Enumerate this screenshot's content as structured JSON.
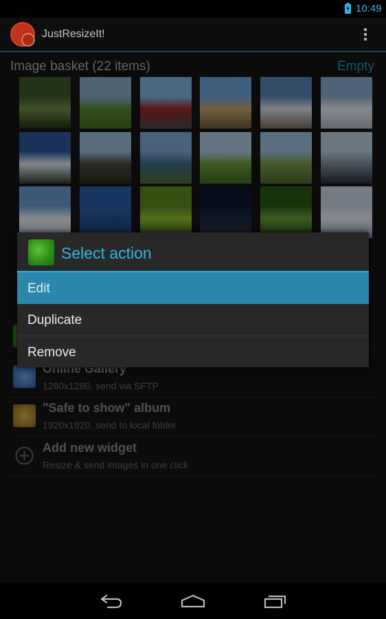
{
  "status": {
    "time": "10:49"
  },
  "app": {
    "title": "JustResizeIt!"
  },
  "basket": {
    "title": "Image basket (22 items)",
    "empty_label": "Empty"
  },
  "thumbnails": [
    {
      "name": "thumb-forest",
      "colors": [
        "#3d5a2a",
        "#6e8a48",
        "#1f3018"
      ]
    },
    {
      "name": "thumb-meadow",
      "colors": [
        "#87a9c9",
        "#5b8a2f",
        "#3e6b1e"
      ]
    },
    {
      "name": "thumb-train",
      "colors": [
        "#7fb3e3",
        "#9c2424",
        "#4a4a4a"
      ]
    },
    {
      "name": "thumb-building",
      "colors": [
        "#6ca2d8",
        "#c4a46a",
        "#6a5a3a"
      ]
    },
    {
      "name": "thumb-snow-hill",
      "colors": [
        "#5a85b8",
        "#d8dde5",
        "#7a6a5a"
      ]
    },
    {
      "name": "thumb-snow-mountains",
      "colors": [
        "#8aa9cc",
        "#e8eef5",
        "#a8b4bf"
      ]
    },
    {
      "name": "thumb-snowy-trees",
      "colors": [
        "#2d5b9a",
        "#e0e8f2",
        "#2f3a30"
      ]
    },
    {
      "name": "thumb-bare-trees",
      "colors": [
        "#9ab8d8",
        "#444a3a",
        "#2a2a22"
      ]
    },
    {
      "name": "thumb-lone-tree",
      "colors": [
        "#7ea7d2",
        "#3e6a8a",
        "#4a6a30"
      ]
    },
    {
      "name": "thumb-green-hills",
      "colors": [
        "#b0c8e0",
        "#6a9a3a",
        "#3a6a22"
      ]
    },
    {
      "name": "thumb-cow-field",
      "colors": [
        "#9ec0dc",
        "#7a9a4a",
        "#4a6a2a"
      ]
    },
    {
      "name": "thumb-lake-shore",
      "colors": [
        "#b8cfe0",
        "#7a8a9a",
        "#2a3038"
      ]
    },
    {
      "name": "thumb-snowfield",
      "colors": [
        "#6a9ad0",
        "#e8eef6",
        "#b8c4d0"
      ]
    },
    {
      "name": "thumb-blue-sky",
      "colors": [
        "#2e5ea6",
        "#24508f",
        "#1d4078"
      ]
    },
    {
      "name": "thumb-plant-closeup",
      "colors": [
        "#5a8a20",
        "#8fbf35",
        "#2a4a10"
      ]
    },
    {
      "name": "thumb-street-lamp",
      "colors": [
        "#0e1830",
        "#1a2a4a",
        "#2a2a2a"
      ]
    },
    {
      "name": "thumb-green-leaves",
      "colors": [
        "#2a5a18",
        "#6aa03a",
        "#1a3a10"
      ]
    },
    {
      "name": "thumb-snow-slope",
      "colors": [
        "#c8d4e4",
        "#e8eef6",
        "#8a9ab0"
      ]
    }
  ],
  "dialog": {
    "title": "Select action",
    "items": [
      {
        "label": "Edit",
        "selected": true
      },
      {
        "label": "Duplicate",
        "selected": false
      },
      {
        "label": "Remove",
        "selected": false
      }
    ]
  },
  "widgets": [
    {
      "title": "Online Gallery",
      "subtitle": "1280x1280, send via SFTP",
      "icon": "gallery-icon"
    },
    {
      "title": "\"Safe to show\" album",
      "subtitle": "1920x1920, send to local folder",
      "icon": "album-icon"
    },
    {
      "title": "Add new widget",
      "subtitle": "Resize & send images in one click",
      "icon": "add-icon"
    }
  ],
  "colors": {
    "accent": "#33b5e5",
    "selected": "#2a88ad"
  }
}
